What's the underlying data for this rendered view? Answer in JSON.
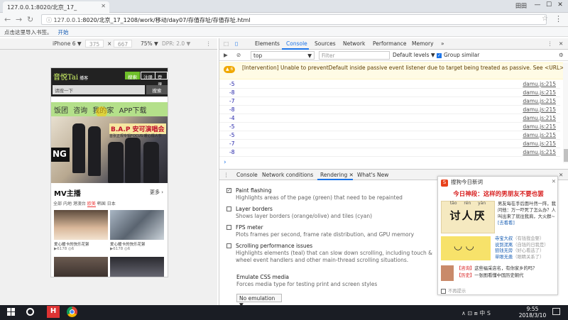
{
  "browser": {
    "tab_title": "127.0.0.1:8020/北京_17_",
    "user_label": "田田",
    "url_host": "127.0.0.1",
    "url_path": ":8020/北京_17_1208/work/移动/day07/存值存址/存值存址.html",
    "bookmarks_prompt": "点击这里导入书签。",
    "bookmarks_link": "开始"
  },
  "device_toolbar": {
    "device": "iPhone 6 ▼",
    "width": "375",
    "times": "×",
    "height": "667",
    "zoom": "75% ▼",
    "dpr": "DPR: 2.0 ▼"
  },
  "phone": {
    "logo": "音悦Tai",
    "logo_sub": "播客",
    "btn_register": "搜索",
    "btn_login": "注册",
    "btn_more": "登录",
    "search_placeholder": "请搜一下",
    "search_btn": "搜索",
    "nav": [
      "饭团",
      "咨询",
      "我的家",
      "APP下载"
    ],
    "banner_title": "B.A.P 安可演唱会",
    "banner_sub": "首张正规专辑FOCUS·暖心情人节",
    "banner_ng": "NG",
    "section_title": "MV主播",
    "section_more": "更多 ›",
    "filters": [
      "全部",
      "内地",
      "港澳台",
      "欧美",
      "韩国",
      "日本"
    ],
    "active_filter": "欧美",
    "card1_caption": "爱心暖卡的快乐花絮",
    "card2_caption": "爱心暖卡的快乐花絮",
    "card1_stats": "▶6178  ◎6",
    "card2_stats": "▶6178  ◎6"
  },
  "devtools": {
    "tabs": [
      "Elements",
      "Console",
      "Sources",
      "Network",
      "Performance",
      "Memory"
    ],
    "active_tab": "Console",
    "more": "»",
    "context": "top",
    "filter_placeholder": "Filter",
    "levels": "Default levels ▼",
    "group_similar": "Group similar",
    "warning_badge": "▲ 6",
    "warning_text": "[Intervention] Unable to preventDefault inside passive event listener due to target being treated as passive. See <URL>",
    "log_source": "damu.js:215",
    "log_values": [
      "-5",
      "-8",
      "-7",
      "-8",
      "-4",
      "-5",
      "-5",
      "-7",
      "-8"
    ],
    "prompt": "›"
  },
  "drawer": {
    "tabs": [
      "Console",
      "Network conditions",
      "Rendering ✕",
      "What's New"
    ],
    "active_tab": "Rendering ✕",
    "options": [
      {
        "title": "Paint flashing",
        "desc": "Highlights areas of the page (green) that need to be repainted",
        "checked": true
      },
      {
        "title": "Layer borders",
        "desc": "Shows layer borders (orange/olive) and tiles (cyan)",
        "checked": false
      },
      {
        "title": "FPS meter",
        "desc": "Plots frames per second, frame rate distribution, and GPU memory",
        "checked": false
      },
      {
        "title": "Scrolling performance issues",
        "desc": "Highlights elements (teal) that can slow down scrolling, including touch & wheel event handlers and other main-thread scrolling situations.",
        "checked": false
      }
    ],
    "emulate_title": "Emulate CSS media",
    "emulate_desc": "Forces media type for testing print and screen styles",
    "emulate_select": "No emulation ▼"
  },
  "sogou": {
    "header": "搜狗今日新词",
    "headline": "今日神段：这样的男朋友不要也罢",
    "pinyin": "tǎo rén yàn",
    "big_word": "讨人厌",
    "desc_text": "男友每在手后面叶然一阵，我问他：万一吓死了怎么办？人叫出来了就往我肩，大火群~",
    "desc_link": "[去看看]",
    "list": [
      {
        "a": "寺宝大叔",
        "b": "（有钱我会娶）"
      },
      {
        "a": "说到泥离",
        "b": "（自钱的日我是）"
      },
      {
        "a": "狙钱无旁",
        "b": "（好心看选了）"
      },
      {
        "a": "单眼无患",
        "b": "（眼睛关系了）"
      }
    ],
    "news1_tag": "【咨询】",
    "news1": "这些福采店名，有你家乡的吗？",
    "news2_tag": "【历史】",
    "news2": "一张图看懂中国历史朝代",
    "footer": "不再提示"
  },
  "taskbar": {
    "hbuilder": "H",
    "tray": "∧  ⊡  ⧈  中  S",
    "time": "9:55",
    "date": "2018/3/10"
  }
}
